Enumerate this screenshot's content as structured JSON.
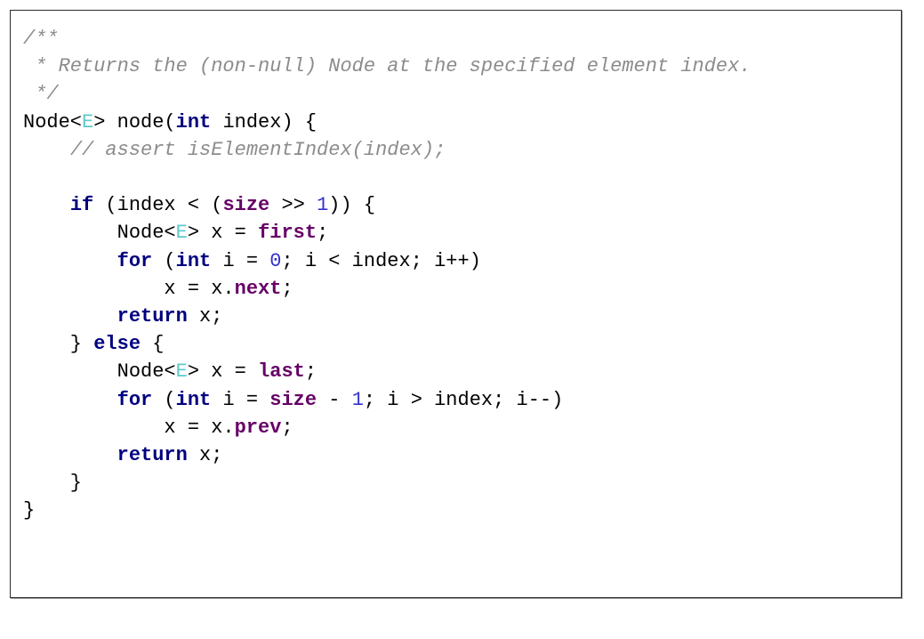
{
  "frame": {
    "border_color": "#2b2b2b",
    "background": "#ffffff",
    "shadow_color": "#9a9a9a"
  },
  "syntax_colors": {
    "comment": "#8c8c8c",
    "keyword": "#000080",
    "field": "#660066",
    "type_parameter": "#5fc9c9",
    "number": "#3333cc",
    "plain": "#000000"
  },
  "code": {
    "language": "java",
    "full_text": "/**\n * Returns the (non-null) Node at the specified element index.\n */\nNode<E> node(int index) {\n    // assert isElementIndex(index);\n\n    if (index < (size >> 1)) {\n        Node<E> x = first;\n        for (int i = 0; i < index; i++)\n            x = x.next;\n        return x;\n    } else {\n        Node<E> x = last;\n        for (int i = size - 1; i > index; i--)\n            x = x.prev;\n        return x;\n    }\n}",
    "lines": [
      {
        "n": 1,
        "text": "/**"
      },
      {
        "n": 2,
        "text": " * Returns the (non-null) Node at the specified element index."
      },
      {
        "n": 3,
        "text": " */"
      },
      {
        "n": 4,
        "text": "Node<E> node(int index) {"
      },
      {
        "n": 5,
        "text": "    // assert isElementIndex(index);"
      },
      {
        "n": 6,
        "text": ""
      },
      {
        "n": 7,
        "text": "    if (index < (size >> 1)) {"
      },
      {
        "n": 8,
        "text": "        Node<E> x = first;"
      },
      {
        "n": 9,
        "text": "        for (int i = 0; i < index; i++)"
      },
      {
        "n": 10,
        "text": "            x = x.next;"
      },
      {
        "n": 11,
        "text": "        return x;"
      },
      {
        "n": 12,
        "text": "    } else {"
      },
      {
        "n": 13,
        "text": "        Node<E> x = last;"
      },
      {
        "n": 14,
        "text": "        for (int i = size - 1; i > index; i--)"
      },
      {
        "n": 15,
        "text": "            x = x.prev;"
      },
      {
        "n": 16,
        "text": "        return x;"
      },
      {
        "n": 17,
        "text": "    }"
      },
      {
        "n": 18,
        "text": "}"
      }
    ],
    "tokens": {
      "l1": [
        {
          "t": "/**",
          "c": "cmt"
        }
      ],
      "l2": [
        {
          "t": " * Returns the (non-null) Node at the specified element index.",
          "c": "cmt"
        }
      ],
      "l3": [
        {
          "t": " */",
          "c": "cmt"
        }
      ],
      "l4": [
        {
          "t": "Node<",
          "c": "pln"
        },
        {
          "t": "E",
          "c": "typ"
        },
        {
          "t": "> node(",
          "c": "pln"
        },
        {
          "t": "int",
          "c": "kw"
        },
        {
          "t": " index) {",
          "c": "pln"
        }
      ],
      "l5": [
        {
          "t": "    ",
          "c": "pln"
        },
        {
          "t": "// assert isElementIndex(index);",
          "c": "cmt"
        }
      ],
      "l6": [
        {
          "t": "",
          "c": "pln"
        }
      ],
      "l7": [
        {
          "t": "    ",
          "c": "pln"
        },
        {
          "t": "if",
          "c": "kw"
        },
        {
          "t": " (index < (",
          "c": "pln"
        },
        {
          "t": "size",
          "c": "fld"
        },
        {
          "t": " >> ",
          "c": "pln"
        },
        {
          "t": "1",
          "c": "num"
        },
        {
          "t": ")) {",
          "c": "pln"
        }
      ],
      "l8": [
        {
          "t": "        Node<",
          "c": "pln"
        },
        {
          "t": "E",
          "c": "typ"
        },
        {
          "t": "> x = ",
          "c": "pln"
        },
        {
          "t": "first",
          "c": "fld"
        },
        {
          "t": ";",
          "c": "pln"
        }
      ],
      "l9": [
        {
          "t": "        ",
          "c": "pln"
        },
        {
          "t": "for",
          "c": "kw"
        },
        {
          "t": " (",
          "c": "pln"
        },
        {
          "t": "int",
          "c": "kw"
        },
        {
          "t": " i = ",
          "c": "pln"
        },
        {
          "t": "0",
          "c": "num"
        },
        {
          "t": "; i < index; i++)",
          "c": "pln"
        }
      ],
      "l10": [
        {
          "t": "            x = x.",
          "c": "pln"
        },
        {
          "t": "next",
          "c": "fld"
        },
        {
          "t": ";",
          "c": "pln"
        }
      ],
      "l11": [
        {
          "t": "        ",
          "c": "pln"
        },
        {
          "t": "return",
          "c": "kw"
        },
        {
          "t": " x;",
          "c": "pln"
        }
      ],
      "l12": [
        {
          "t": "    } ",
          "c": "pln"
        },
        {
          "t": "else",
          "c": "kw"
        },
        {
          "t": " {",
          "c": "pln"
        }
      ],
      "l13": [
        {
          "t": "        Node<",
          "c": "pln"
        },
        {
          "t": "E",
          "c": "typ"
        },
        {
          "t": "> x = ",
          "c": "pln"
        },
        {
          "t": "last",
          "c": "fld"
        },
        {
          "t": ";",
          "c": "pln"
        }
      ],
      "l14": [
        {
          "t": "        ",
          "c": "pln"
        },
        {
          "t": "for",
          "c": "kw"
        },
        {
          "t": " (",
          "c": "pln"
        },
        {
          "t": "int",
          "c": "kw"
        },
        {
          "t": " i = ",
          "c": "pln"
        },
        {
          "t": "size",
          "c": "fld"
        },
        {
          "t": " - ",
          "c": "pln"
        },
        {
          "t": "1",
          "c": "num"
        },
        {
          "t": "; i > index; i--)",
          "c": "pln"
        }
      ],
      "l15": [
        {
          "t": "            x = x.",
          "c": "pln"
        },
        {
          "t": "prev",
          "c": "fld"
        },
        {
          "t": ";",
          "c": "pln"
        }
      ],
      "l16": [
        {
          "t": "        ",
          "c": "pln"
        },
        {
          "t": "return",
          "c": "kw"
        },
        {
          "t": " x;",
          "c": "pln"
        }
      ],
      "l17": [
        {
          "t": "    }",
          "c": "pln"
        }
      ],
      "l18": [
        {
          "t": "}",
          "c": "pln"
        }
      ]
    }
  }
}
